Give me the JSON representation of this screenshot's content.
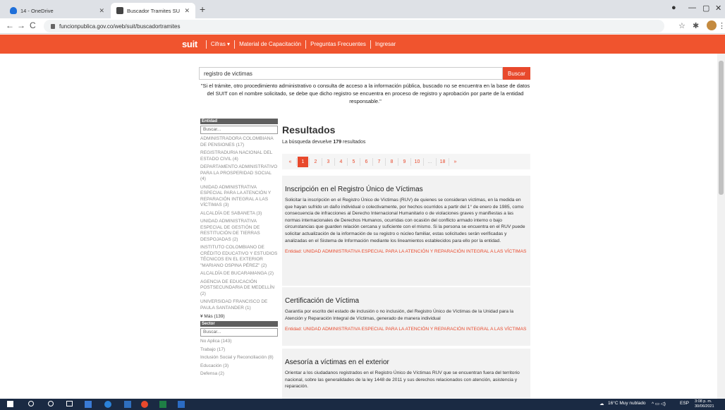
{
  "browser": {
    "tabs": [
      {
        "title": "14 - OneDrive",
        "icon": "onedrive-icon"
      },
      {
        "title": "Buscador Tramites SUIT DAFP-Fu",
        "icon": "site-icon"
      }
    ],
    "url": "funcionpublica.gov.co/web/suit/buscadortramites"
  },
  "site": {
    "logo": "suit",
    "nav": [
      {
        "label": "Cifras ▾"
      },
      {
        "label": "Material de Capacitación"
      },
      {
        "label": "Preguntas Frecuentes"
      },
      {
        "label": "Ingresar"
      }
    ],
    "search_value": "registro de victimas",
    "search_button": "Buscar",
    "notice": "\"Si el trámite, otro procedimiento administrativo o consulta de acceso a la información pública, buscado no se encuentra en la base de datos del SUIT con el nombre solicitado, se debe que dicho registro se encuentra en proceso de registro y aprobación por parte de la entidad responsable.\""
  },
  "sidebar": {
    "entidad_header": "Entidad",
    "entidad_placeholder": "Buscar...",
    "entidades": [
      "ADMINISTRADORA COLOMBIANA DE PENSIONES (17)",
      "REGISTRADURIA NACIONAL DEL ESTADO CIVIL (4)",
      "DEPARTAMENTO ADMINISTRATIVO PARA LA PROSPERIDAD SOCIAL (4)",
      "UNIDAD ADMINISTRATIVA ESPECIAL PARA LA ATENCIÓN Y REPARACIÓN INTEGRAL A LAS VÍCTIMAS (3)",
      "ALCALDÍA DE SABANETA (3)",
      "UNIDAD ADMINISTRATIVA ESPECIAL DE GESTIÓN DE RESTITUCIÓN DE TIERRAS DESPOJADAS (2)",
      "INSTITUTO COLOMBIANO DE CRÉDITO EDUCATIVO Y ESTUDIOS TÉCNICOS EN EL EXTERIOR \"MARIANO OSPINA PÉREZ\" (2)",
      "ALCALDÍA DE BUCARAMANGA (2)",
      "AGENCIA DE EDUCACIÓN POSTSECUNDARIA DE MEDELLÍN (2)",
      "UNIVERSIDAD FRANCISCO DE PAULA SANTANDER (1)"
    ],
    "mas": "¥ Más (139)",
    "sector_header": "Sector",
    "sector_placeholder": "Buscar...",
    "sectores": [
      "No Aplica (143)",
      "Trabajo (17)",
      "Inclusión Social y Reconciliación (8)",
      "Educación (3)",
      "Defensa (2)"
    ]
  },
  "results": {
    "title": "Resultados",
    "count_prefix": "La búsqueda devuelve ",
    "count": "179",
    "count_suffix": " resultados",
    "pages": [
      "«",
      "1",
      "2",
      "3",
      "4",
      "5",
      "6",
      "7",
      "8",
      "9",
      "10",
      "...",
      "18",
      "»"
    ],
    "active_page": "1",
    "entity_label": "Entidad: ",
    "items": [
      {
        "title": "Inscripción en el Registro Único de Víctimas",
        "desc": "Solicitar la inscripción en el Registro Único de Víctimas (RUV) de quienes se consideran víctimas, en la medida en que hayan sufrido un daño individual o colectivamente, por hechos ocurridos a partir del 1° de enero de 1985, como consecuencia de infracciones al Derecho Internacional Humanitario o de violaciones graves y manifiestas a las normas internacionales de Derechos Humanos, ocurridas con ocasión del conflicto armado interno o bajo circunstancias que guarden relación cercana y suficiente con el mismo. Si la persona se encuentra en el RUV puede solicitar actualización de la información de su registro o núcleo familiar, estas solicitudes serán verificadas y analizadas en el Sistema de Información mediante los lineamientos establecidos para ello por la entidad.",
        "entity": "UNIDAD ADMINISTRATIVA ESPECIAL PARA LA ATENCIÓN Y REPARACIÓN INTEGRAL A LAS VÍCTIMAS"
      },
      {
        "title": "Certificación de Víctima",
        "desc": "Garantía por escrito del estado de inclusión o no inclusión, del Registro Único de Víctimas de la Unidad para la Atención y Reparación Integral de Víctimas, generado de manera individual",
        "entity": "UNIDAD ADMINISTRATIVA ESPECIAL PARA LA ATENCIÓN Y REPARACIÓN INTEGRAL A LAS VÍCTIMAS"
      },
      {
        "title": "Asesoría a víctimas en el exterior",
        "desc": "Orientar a los ciudadanos registrados en el Registro Único de Víctimas RUV que se encuentran fuera del territorio nacional, sobre las generalidades de la ley 1448 de 2011 y sus derechos relacionados con atención, asistencia y reparación.",
        "entity": ""
      }
    ]
  },
  "taskbar": {
    "weather": "16°C Muy nublado",
    "lang": "ESP",
    "time": "3:08 p. m.",
    "date": "30/06/2021"
  },
  "colors": {
    "brand": "#f0542e",
    "accent": "#e8492c"
  }
}
